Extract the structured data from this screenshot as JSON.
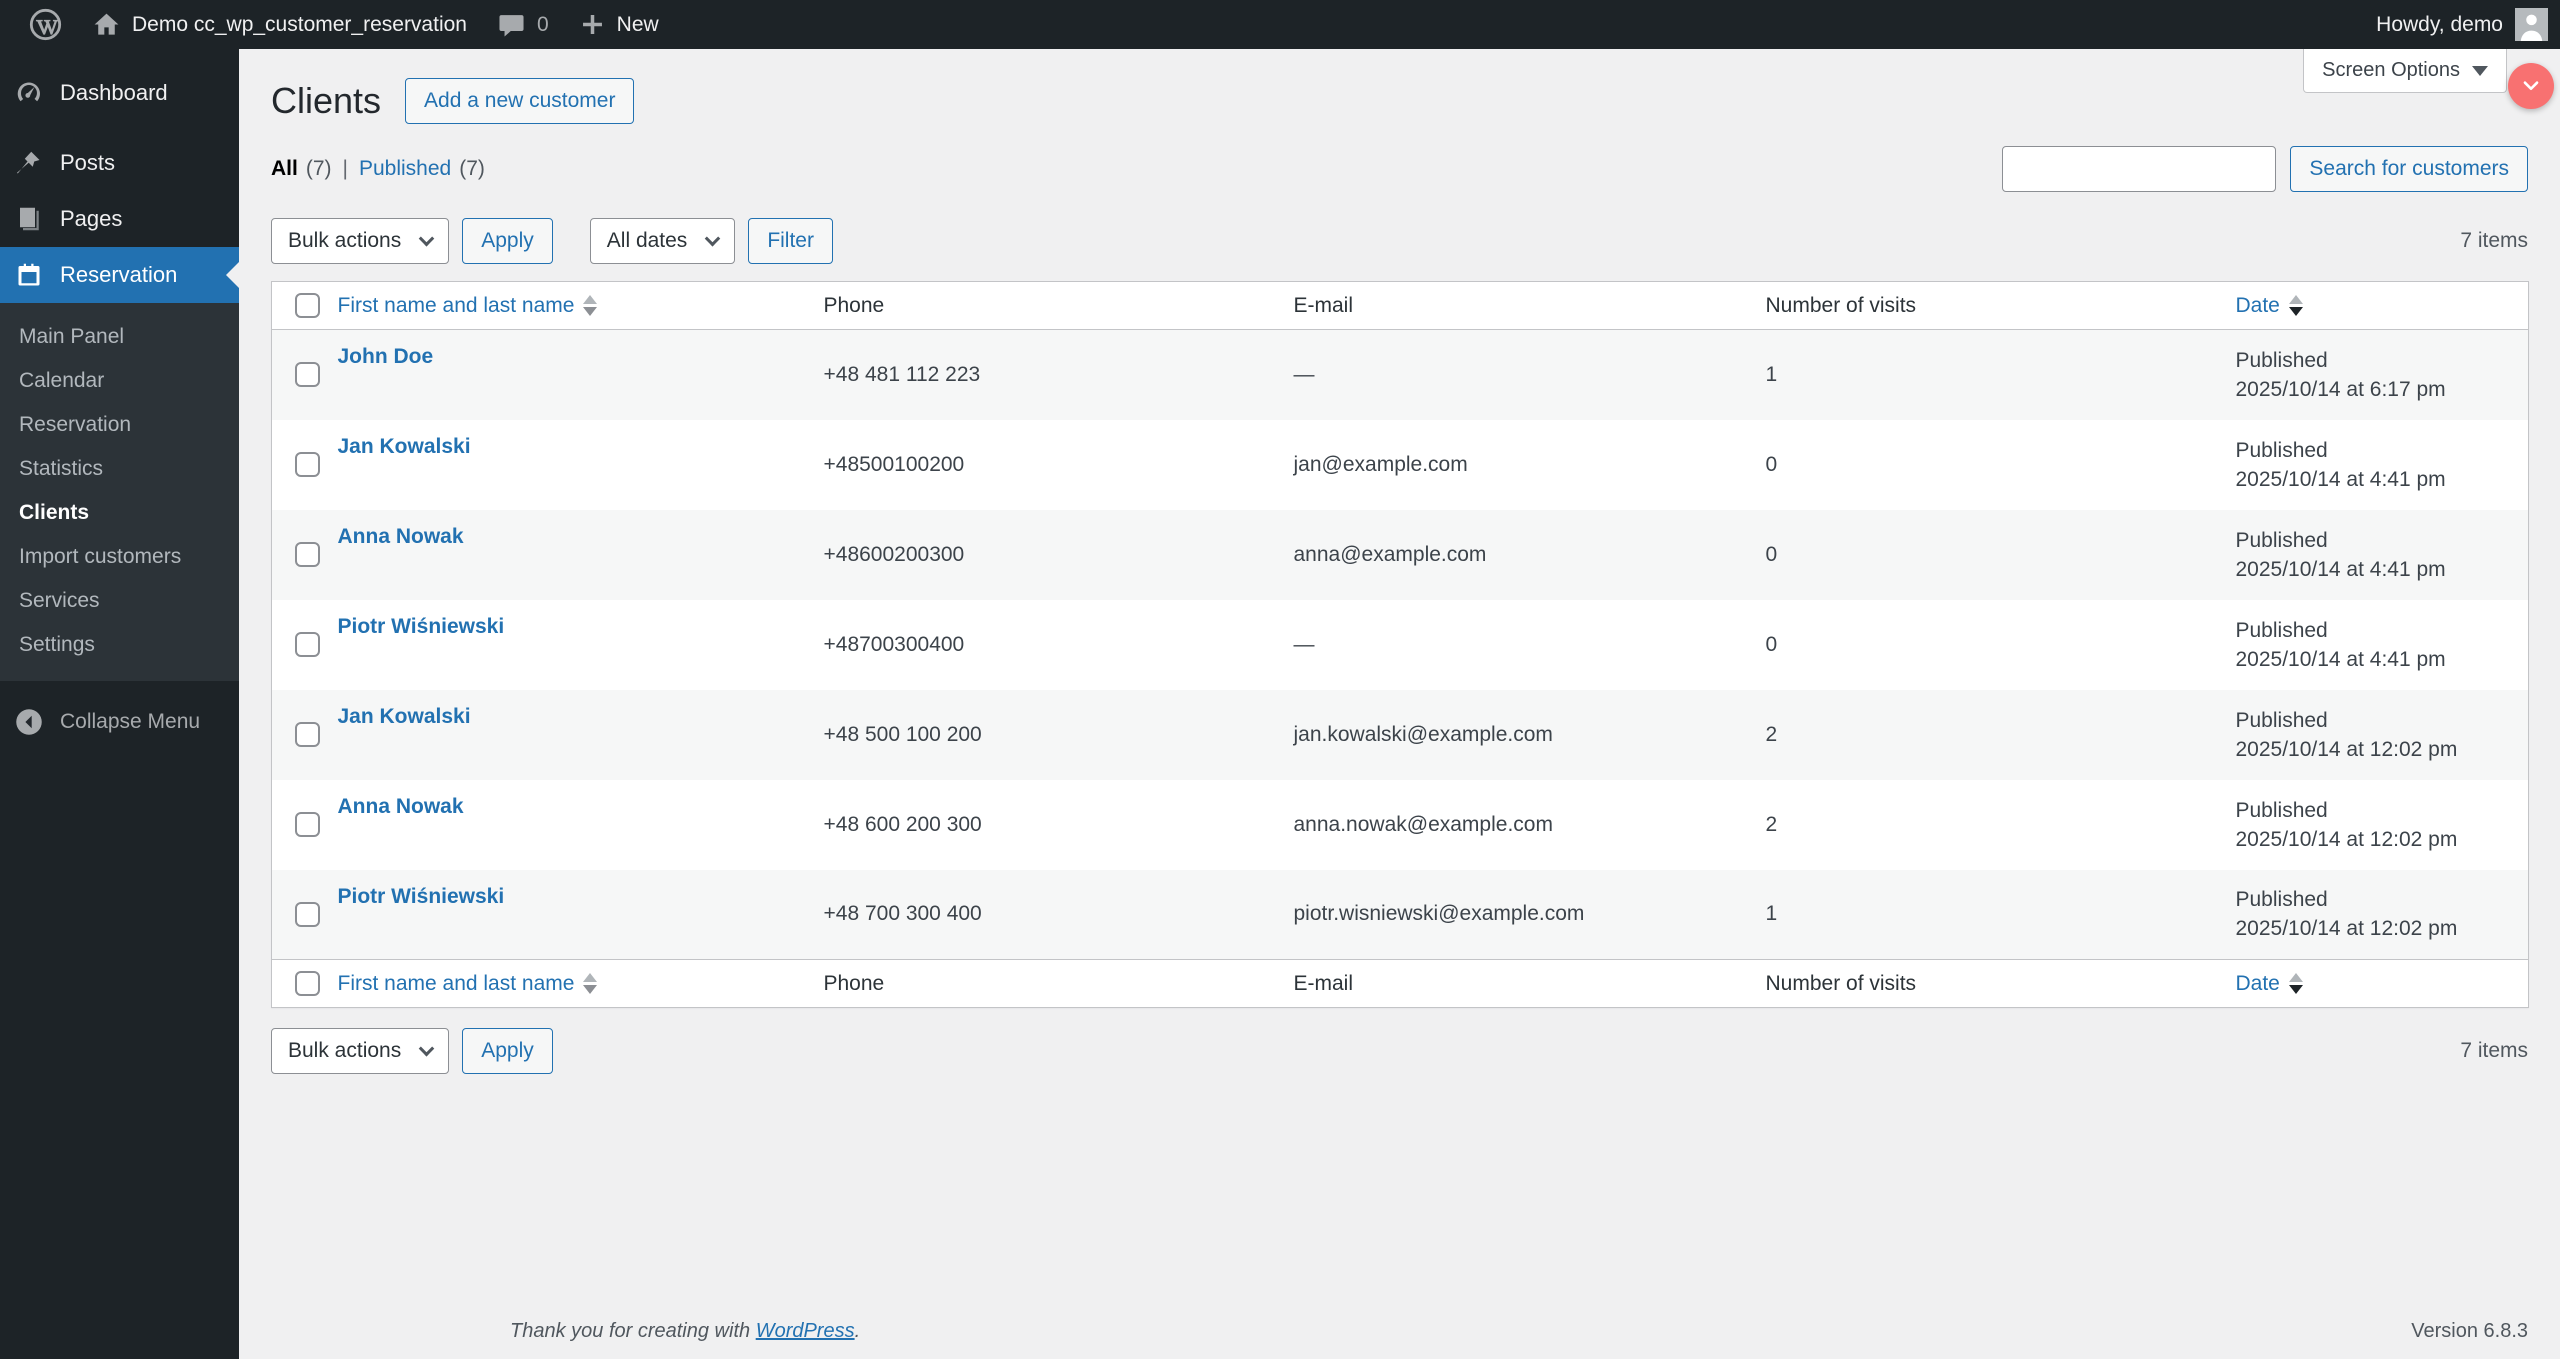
{
  "admin_bar": {
    "site_name": "Demo cc_wp_customer_reservation",
    "comments_count": "0",
    "new_label": "New",
    "howdy_label": "Howdy, demo"
  },
  "sidebar": {
    "items": [
      {
        "label": "Dashboard"
      },
      {
        "label": "Posts"
      },
      {
        "label": "Pages"
      },
      {
        "label": "Reservation"
      }
    ],
    "submenu": [
      {
        "label": "Main Panel"
      },
      {
        "label": "Calendar"
      },
      {
        "label": "Reservation"
      },
      {
        "label": "Statistics"
      },
      {
        "label": "Clients"
      },
      {
        "label": "Import customers"
      },
      {
        "label": "Services"
      },
      {
        "label": "Settings"
      }
    ],
    "collapse_label": "Collapse Menu"
  },
  "page": {
    "screen_options_label": "Screen Options",
    "title": "Clients",
    "add_button_label": "Add a new customer",
    "views": {
      "all_label": "All",
      "all_count": "(7)",
      "separator": "|",
      "published_label": "Published",
      "published_count": "(7)"
    },
    "search_button_label": "Search for customers",
    "bulk_actions_value": "Bulk actions",
    "apply_label": "Apply",
    "dates_value": "All dates",
    "filter_label": "Filter",
    "items_count": "7 items"
  },
  "table": {
    "columns": [
      {
        "label": "First name and last name",
        "sortable": true,
        "sorted": "none"
      },
      {
        "label": "Phone",
        "sortable": false
      },
      {
        "label": "E-mail",
        "sortable": false
      },
      {
        "label": "Number of visits",
        "sortable": false
      },
      {
        "label": "Date",
        "sortable": true,
        "sorted": "desc"
      }
    ],
    "rows": [
      {
        "name": "John Doe",
        "phone": "+48 481 112 223",
        "email": "—",
        "visits": "1",
        "status": "Published",
        "date": "2025/10/14 at 6:17 pm"
      },
      {
        "name": "Jan Kowalski",
        "phone": "+48500100200",
        "email": "jan@example.com",
        "visits": "0",
        "status": "Published",
        "date": "2025/10/14 at 4:41 pm"
      },
      {
        "name": "Anna Nowak",
        "phone": "+48600200300",
        "email": "anna@example.com",
        "visits": "0",
        "status": "Published",
        "date": "2025/10/14 at 4:41 pm"
      },
      {
        "name": "Piotr Wiśniewski",
        "phone": "+48700300400",
        "email": "—",
        "visits": "0",
        "status": "Published",
        "date": "2025/10/14 at 4:41 pm"
      },
      {
        "name": "Jan Kowalski",
        "phone": "+48 500 100 200",
        "email": "jan.kowalski@example.com",
        "visits": "2",
        "status": "Published",
        "date": "2025/10/14 at 12:02 pm"
      },
      {
        "name": "Anna Nowak",
        "phone": "+48 600 200 300",
        "email": "anna.nowak@example.com",
        "visits": "2",
        "status": "Published",
        "date": "2025/10/14 at 12:02 pm"
      },
      {
        "name": "Piotr Wiśniewski",
        "phone": "+48 700 300 400",
        "email": "piotr.wisniewski@example.com",
        "visits": "1",
        "status": "Published",
        "date": "2025/10/14 at 12:02 pm"
      }
    ]
  },
  "footer": {
    "thanks_prefix": "Thank you for creating with ",
    "wordpress_link_label": "WordPress",
    "thanks_suffix": ".",
    "version": "Version 6.8.3"
  },
  "colors": {
    "accent": "#2271b1",
    "admin_bar_bg": "#1d2327",
    "submenu_bg": "#2c3338",
    "fab": "#f87171",
    "row_alt_bg": "#f6f7f7",
    "content_bg": "#f0f0f1"
  }
}
